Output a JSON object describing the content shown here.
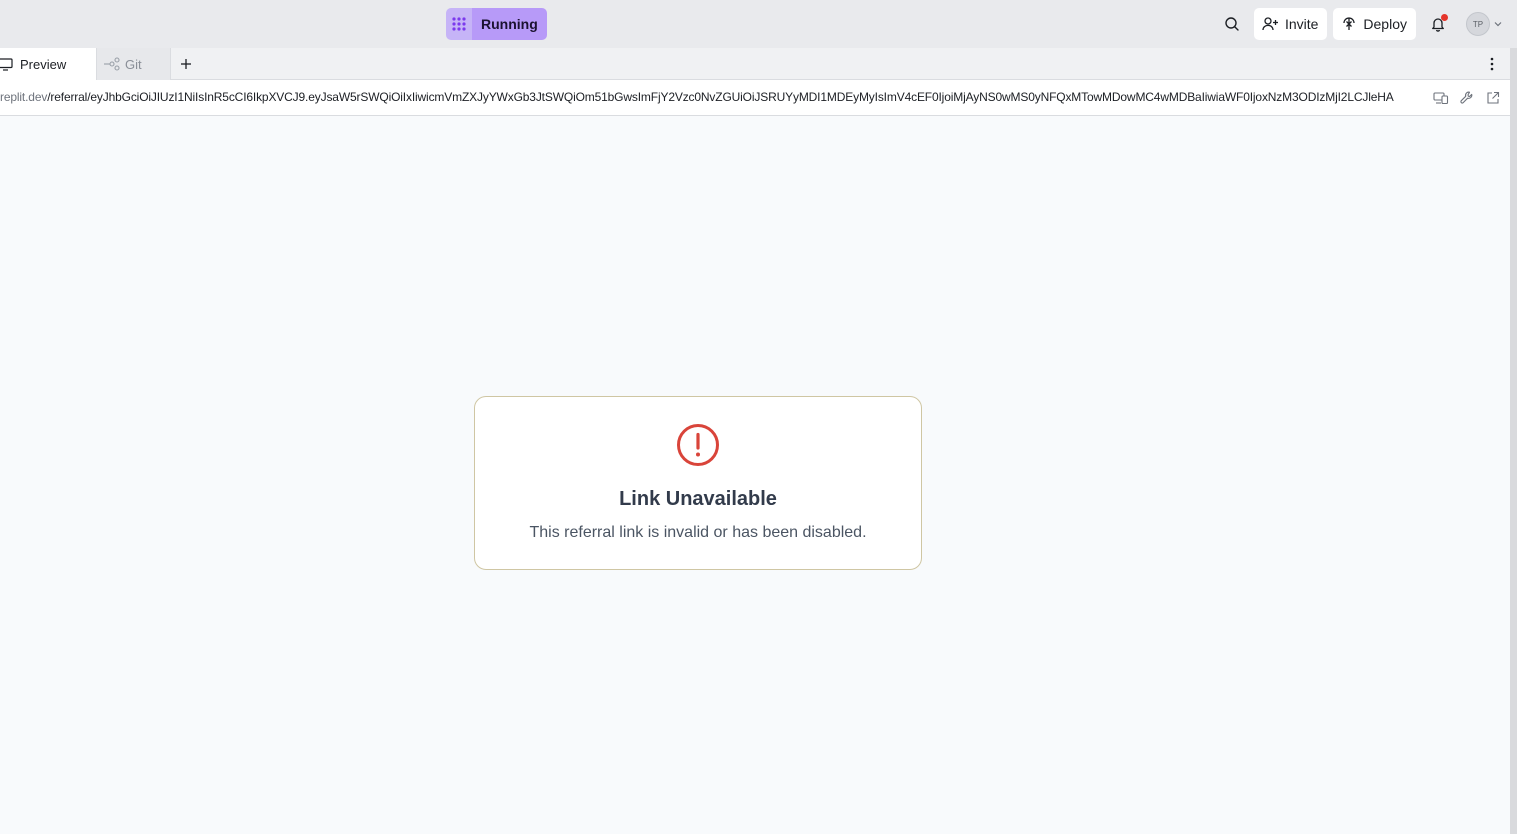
{
  "topbar": {
    "run_label": "Running",
    "invite_label": "Invite",
    "deploy_label": "Deploy",
    "avatar_initials": "TP",
    "accent_color": "#b79af8",
    "notification_dot_color": "#e5352b"
  },
  "tabs": [
    {
      "label": "Preview",
      "icon": "monitor-icon",
      "active": true
    },
    {
      "label": "Git",
      "icon": "git-branch-icon",
      "active": false
    }
  ],
  "url": {
    "host": "replit.dev",
    "path": "/referral/eyJhbGciOiJIUzI1NiIsInR5cCI6IkpXVCJ9.eyJsaW5rSWQiOiIxIiwicmVmZXJyYWxGb3JtSWQiOm51bGwsImFjY2Vzc0NvZGUiOiJSRUYyMDI1MDEyMyIsImV4cEF0IjoiMjAyNS0wMS0yNFQxMTowMDowMC4wMDBaIiwiaWF0IjoxNzM3ODIzMjI2LCJleHA"
  },
  "error_card": {
    "icon": "alert-circle-icon",
    "title": "Link Unavailable",
    "message": "This referral link is invalid or has been disabled.",
    "icon_color": "#d9443a"
  }
}
